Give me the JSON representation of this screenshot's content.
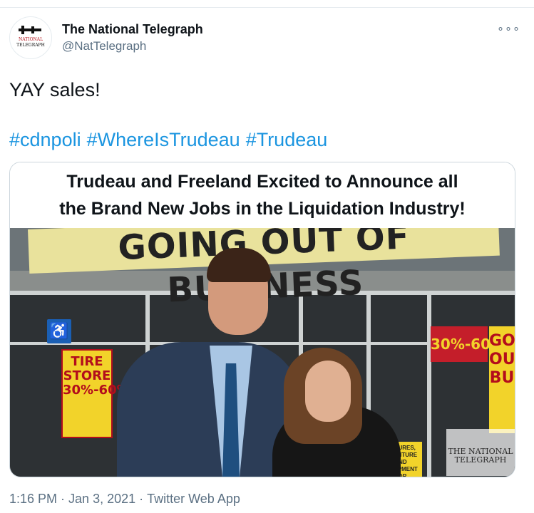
{
  "author": {
    "name": "The National Telegraph",
    "handle": "@NatTelegraph",
    "avatar_text": "THE NATIONAL TELEGRAPH"
  },
  "tweet": {
    "text": "YAY sales!",
    "hashtags": [
      "#cdnpoli",
      "#WhereIsTrudeau",
      "#Trudeau"
    ]
  },
  "media": {
    "headline_line1": "Trudeau and Freeland Excited to Announce all",
    "headline_line2": "the Brand New Jobs in the Liquidation Industry!",
    "banner_text": "GOING OUT OF BUSINESS",
    "store_sign": "TIRE STORE 30%-60%",
    "percent_sign": "30%-60%",
    "go_sign": "GO OU BU",
    "fixtures_sign": "FIXTURES, FURNITURE AND EQUIPMENT FOR",
    "watermark": "THE NATIONAL TELEGRAPH"
  },
  "meta": {
    "time": "1:16 PM",
    "date": "Jan 3, 2021",
    "source": "Twitter Web App",
    "separator": "·"
  },
  "icons": {
    "more": "more-options-icon",
    "accessible": "wheelchair-icon"
  },
  "colors": {
    "hashtag": "#1b95e0",
    "secondary_text": "#5b7083",
    "banner": "#e9e29c"
  }
}
